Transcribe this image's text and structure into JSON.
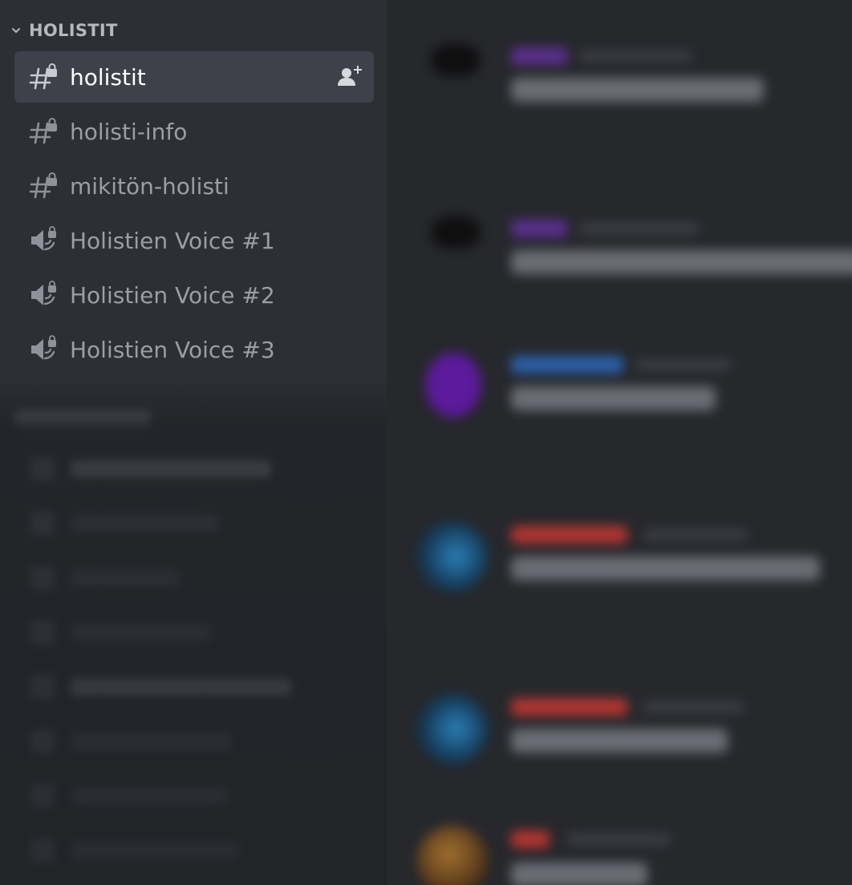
{
  "sidebar": {
    "category": {
      "label": "HOLISTIT"
    },
    "channels": [
      {
        "label": "holistit",
        "type": "text-locked",
        "active": true
      },
      {
        "label": "holisti-info",
        "type": "text-locked",
        "active": false
      },
      {
        "label": "mikitön-holisti",
        "type": "text-locked",
        "active": false
      },
      {
        "label": "Holistien Voice #1",
        "type": "voice-locked",
        "active": false
      },
      {
        "label": "Holistien Voice #2",
        "type": "voice-locked",
        "active": false
      },
      {
        "label": "Holistien Voice #3",
        "type": "voice-locked",
        "active": false
      }
    ],
    "icons": {
      "category_toggle": "chevron-down-icon",
      "text_channel": "hashtag-lock-icon",
      "voice_channel": "speaker-lock-icon",
      "invite": "add-member-icon"
    }
  },
  "colors": {
    "sidebar_bg": "#2d2f34",
    "main_bg": "#26282c",
    "active_item": "#3e4149",
    "text_muted": "#9a9ea6",
    "text_active": "#ffffff",
    "username_purple": "#6f3fb0",
    "username_blue": "#2e6fc4",
    "username_red": "#c03a34"
  }
}
